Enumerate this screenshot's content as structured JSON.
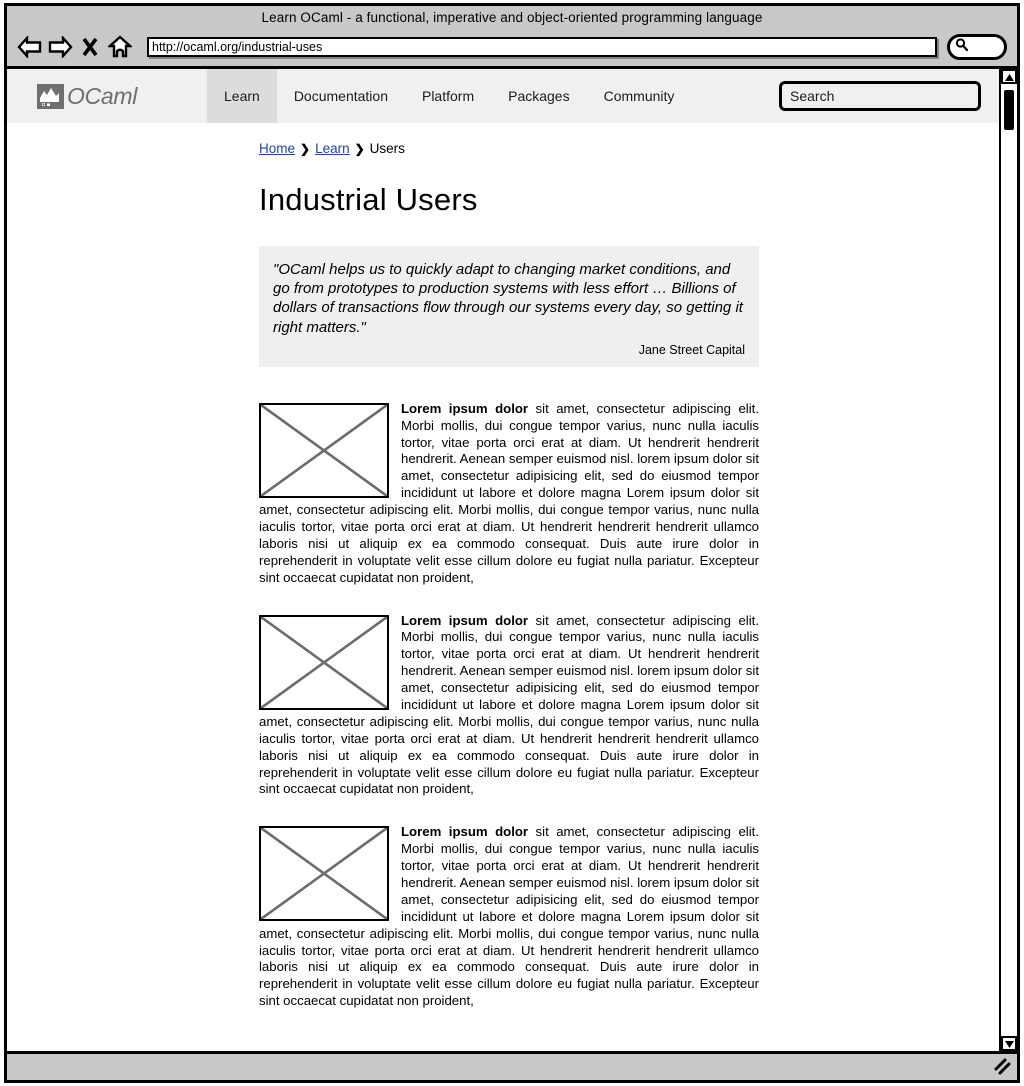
{
  "browser": {
    "title": "Learn OCaml - a functional, imperative and object-oriented programming language",
    "url": "http://ocaml.org/industrial-uses",
    "back_icon": "back-arrow-icon",
    "forward_icon": "forward-arrow-icon",
    "stop_icon": "close-x-icon",
    "home_icon": "home-icon",
    "search_icon": "magnifier-icon"
  },
  "site_header": {
    "logo_text": "OCaml",
    "logo_icon": "ocaml-camel-logo-icon",
    "nav": [
      {
        "label": "Learn",
        "active": true
      },
      {
        "label": "Documentation",
        "active": false
      },
      {
        "label": "Platform",
        "active": false
      },
      {
        "label": "Packages",
        "active": false
      },
      {
        "label": "Community",
        "active": false
      }
    ],
    "search_placeholder": "Search"
  },
  "breadcrumb": {
    "items": [
      {
        "label": "Home",
        "link": true
      },
      {
        "label": "Learn",
        "link": true
      },
      {
        "label": "Users",
        "link": false
      }
    ],
    "separator": "❯"
  },
  "page": {
    "title": "Industrial Users"
  },
  "quote": {
    "text": "\"OCaml helps us to quickly adapt to changing market conditions, and go from prototypes to production systems with less effort … Billions of dollars of transactions flow through our systems every day, so getting it right matters.\"",
    "author": "Jane Street Capital"
  },
  "articles": [
    {
      "image_alt": "image-placeholder",
      "lead": "Lorem ipsum dolor",
      "body": " sit amet, consectetur adipiscing elit. Morbi mollis, dui congue tempor varius, nunc nulla iaculis tortor, vitae porta orci erat at diam. Ut hendrerit hendrerit hendrerit. Aenean semper euismod nisl. lorem ipsum dolor sit amet, consectetur adipisicing elit, sed do eiusmod tempor incididunt ut labore et dolore magna Lorem ipsum dolor sit amet, consectetur adipiscing elit. Morbi mollis, dui congue tempor varius, nunc nulla iaculis tortor, vitae porta orci erat at diam. Ut hendrerit hendrerit hendrerit ullamco laboris nisi ut aliquip ex ea commodo consequat. Duis aute irure dolor in reprehenderit in voluptate velit esse cillum dolore eu fugiat nulla pariatur. Excepteur sint occaecat cupidatat non proident,"
    },
    {
      "image_alt": "image-placeholder",
      "lead": "Lorem ipsum dolor",
      "body": " sit amet, consectetur adipiscing elit. Morbi mollis, dui congue tempor varius, nunc nulla iaculis tortor, vitae porta orci erat at diam. Ut hendrerit hendrerit hendrerit. Aenean semper euismod nisl. lorem ipsum dolor sit amet, consectetur adipisicing elit, sed do eiusmod tempor incididunt ut labore et dolore magna Lorem ipsum dolor sit amet, consectetur adipiscing elit. Morbi mollis, dui congue tempor varius, nunc nulla iaculis tortor, vitae porta orci erat at diam. Ut hendrerit hendrerit hendrerit ullamco laboris nisi ut aliquip ex ea commodo consequat. Duis aute irure dolor in reprehenderit in voluptate velit esse cillum dolore eu fugiat nulla pariatur. Excepteur sint occaecat cupidatat non proident,"
    },
    {
      "image_alt": "image-placeholder",
      "lead": "Lorem ipsum dolor",
      "body": " sit amet, consectetur adipiscing elit. Morbi mollis, dui congue tempor varius, nunc nulla iaculis tortor, vitae porta orci erat at diam. Ut hendrerit hendrerit hendrerit. Aenean semper euismod nisl. lorem ipsum dolor sit amet, consectetur adipisicing elit, sed do eiusmod tempor incididunt ut labore et dolore magna Lorem ipsum dolor sit amet, consectetur adipiscing elit. Morbi mollis, dui congue tempor varius, nunc nulla iaculis tortor, vitae porta orci erat at diam. Ut hendrerit hendrerit hendrerit ullamco laboris nisi ut aliquip ex ea commodo consequat. Duis aute irure dolor in reprehenderit in voluptate velit esse cillum dolore eu fugiat nulla pariatur. Excepteur sint occaecat cupidatat non proident,"
    }
  ],
  "scrollbar": {
    "up_arrow_icon": "triangle-up-icon",
    "down_arrow_icon": "triangle-down-icon",
    "thumb": "scroll-thumb"
  },
  "colors": {
    "link": "#2244aa",
    "header_bg": "#f0f0f0",
    "nav_active_bg": "#dcdcdc",
    "quote_bg": "#efefef",
    "chrome_bg": "#c8c8c8",
    "logo": "#6f6f6f"
  }
}
